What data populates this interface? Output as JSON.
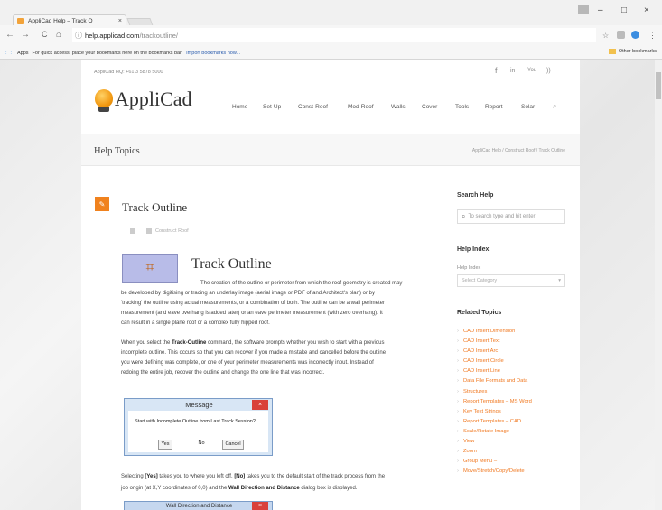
{
  "browser": {
    "tab_title": "AppliCad Help – Track O",
    "tab_close": "×",
    "url_host": "help.applicad.com",
    "url_path": "/trackoutline/",
    "bookmarks_apps": "Apps",
    "bookmarks_hint": "For quick access, place your bookmarks here on the bookmarks bar.",
    "bookmarks_import": "Import bookmarks now...",
    "other_bookmarks": "Other bookmarks",
    "nav_back": "←",
    "nav_forward": "→",
    "nav_reload": "C",
    "nav_home": "⌂",
    "info_icon": "ⓘ",
    "star": "☆",
    "menu": "⋮",
    "win_min": "–",
    "win_max": "□",
    "win_close": "×"
  },
  "site": {
    "hq": "AppliCad HQ: +61 3 5878 5000",
    "social": [
      "f",
      "in",
      "You",
      "))"
    ],
    "logo_text": "AppliCad",
    "menu": [
      "Home",
      "Set-Up",
      "Const-Roof",
      "Mod-Roof",
      "Walls",
      "Cover",
      "Tools",
      "Report",
      "Solar"
    ],
    "menu_search": "⌕"
  },
  "help_bar": {
    "title": "Help Topics",
    "breadcrumb": "AppliCad Help / Construct Roof / Track Outline"
  },
  "article": {
    "title": "Track Outline",
    "category": "Construct Roof",
    "heading": "Track Outline",
    "p1_lines": [
      "The creation of the outline or perimeter from which the roof geometry is created may",
      "be developed by digitising or tracing an underlay image (aerial image or PDF of and Architect's plan) or by",
      "'tracking' the outline using actual measurements, or a combination of both. The outline can be a wall perimeter",
      "measurement (and eave overhang is added later) or an eave perimeter measurement (with zero overhang).  It",
      "can result in a single plane roof or a complex fully hipped roof."
    ],
    "p2_lines": [
      [
        "When you select the ",
        "Track-Outline",
        " command, the software prompts whether you wish to start with a previous"
      ],
      [
        "incomplete outline. This occurs so that you can recover if you made a mistake and cancelled before the outline",
        "",
        ""
      ],
      [
        "you were defining was complete, or one of your perimeter measurements was incorrectly input.   Instead of",
        "",
        ""
      ],
      [
        "redoing the entire job, recover the outline and change the one line that was incorrect.",
        "",
        ""
      ]
    ],
    "p3_line1_a": "Selecting ",
    "p3_yes": "[Yes]",
    "p3_line1_b": " takes you to where you left off.   ",
    "p3_no": "[No]",
    "p3_line1_c": " takes you to the default start of the track process from the",
    "p3_line2_a": "job origin (at X,Y coordinates of 0,0) and the ",
    "p3_bold": "Wall Direction and Distance",
    "p3_line2_b": " dialog box is displayed."
  },
  "dialog": {
    "title": "Message",
    "close": "×",
    "message": "Start with Incomplete Outline from Last Track Session?",
    "yes": "Yes",
    "no": "No",
    "cancel": "Cancel"
  },
  "dialog2": {
    "title": "Wall Direction and Distance"
  },
  "sidebar": {
    "search_heading": "Search Help",
    "search_placeholder": "To search type and hit enter",
    "help_index_heading": "Help Index",
    "help_index_label": "Help Index",
    "help_index_select": "Select Category",
    "related_heading": "Related Topics",
    "related": [
      "CAD Insert Dimension",
      "CAD Insert Text",
      "CAD Insert Arc",
      "CAD Insert Circle",
      "CAD Insert Line",
      "Data File Formats and Data",
      "Structures",
      "Report Templates – MS Word",
      "Key Text Strings",
      "Report Templates – CAD",
      "Scale/Rotate Image",
      "View",
      "Zoom",
      "Group Menu –",
      "Move/Stretch/Copy/Delete"
    ]
  }
}
